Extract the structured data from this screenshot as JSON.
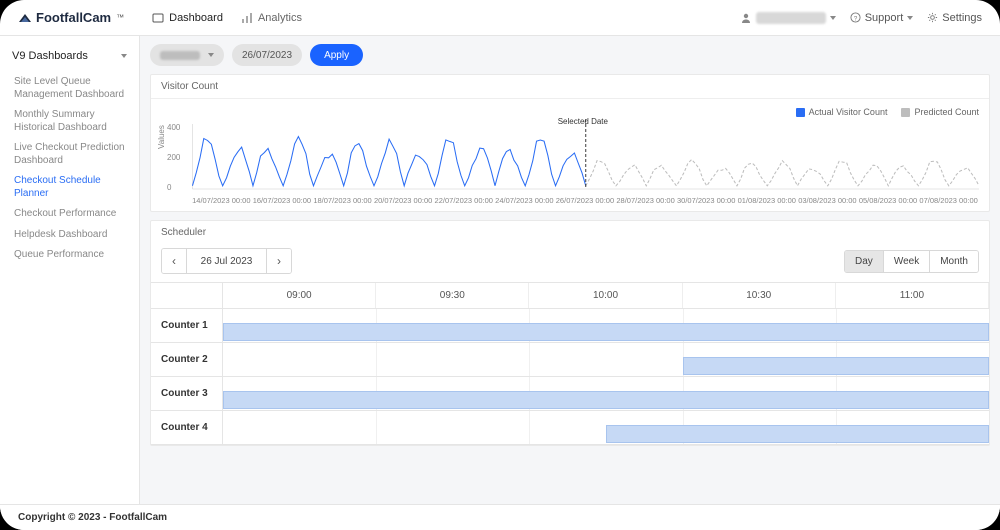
{
  "brand": "FootfallCam",
  "topnav": {
    "dashboard": "Dashboard",
    "analytics": "Analytics"
  },
  "topbar_right": {
    "support": "Support",
    "settings": "Settings"
  },
  "sidebar": {
    "group": "V9 Dashboards",
    "items": [
      "Site Level Queue Management Dashboard",
      "Monthly Summary Historical Dashboard",
      "Live Checkout Prediction Dashboard",
      "Checkout Schedule Planner",
      "Checkout Performance",
      "Helpdesk Dashboard",
      "Queue Performance"
    ],
    "active_index": 3
  },
  "filters": {
    "date": "26/07/2023",
    "apply": "Apply"
  },
  "chart_panel": {
    "title": "Visitor Count",
    "ylabel": "Values",
    "legend_actual": "Actual Visitor Count",
    "legend_predicted": "Predicted Count",
    "selected_date_label": "Selected Date"
  },
  "chart_data": {
    "type": "line",
    "ylabel": "Values",
    "ylim": [
      0,
      400
    ],
    "yticks": [
      0,
      200,
      400
    ],
    "selected_date": "26/07/2023 00:00",
    "xticks": [
      "14/07/2023 00:00",
      "16/07/2023 00:00",
      "18/07/2023 00:00",
      "20/07/2023 00:00",
      "22/07/2023 00:00",
      "24/07/2023 00:00",
      "26/07/2023 00:00",
      "28/07/2023 00:00",
      "30/07/2023 00:00",
      "01/08/2023 00:00",
      "03/08/2023 00:00",
      "05/08/2023 00:00",
      "07/08/2023 00:00"
    ],
    "series": [
      {
        "name": "Actual Visitor Count",
        "color": "#2a6df4",
        "style": "solid",
        "x_range": [
          "13/07/2023",
          "26/07/2023"
        ],
        "pattern": "daily-peaks",
        "approx_peak_range": [
          200,
          320
        ],
        "approx_trough": 20
      },
      {
        "name": "Predicted Count",
        "color": "#bdbdbd",
        "style": "dashed",
        "x_range": [
          "26/07/2023",
          "08/08/2023"
        ],
        "pattern": "daily-peaks",
        "approx_peak_range": [
          120,
          180
        ],
        "approx_trough": 20
      }
    ]
  },
  "scheduler": {
    "title": "Scheduler",
    "date_label": "26 Jul 2023",
    "views": {
      "day": "Day",
      "week": "Week",
      "month": "Month"
    },
    "active_view": "day",
    "time_headers": [
      "09:00",
      "09:30",
      "10:00",
      "10:30",
      "11:00"
    ],
    "rows": [
      {
        "label": "Counter 1",
        "bars": [
          {
            "start_pct": 0,
            "end_pct": 100
          }
        ]
      },
      {
        "label": "Counter 2",
        "bars": [
          {
            "start_pct": 60,
            "end_pct": 100
          }
        ]
      },
      {
        "label": "Counter 3",
        "bars": [
          {
            "start_pct": 0,
            "end_pct": 100
          }
        ]
      },
      {
        "label": "Counter 4",
        "bars": [
          {
            "start_pct": 50,
            "end_pct": 100
          }
        ]
      }
    ]
  },
  "footer": {
    "copyright": "Copyright © 2023 - FootfallCam"
  }
}
